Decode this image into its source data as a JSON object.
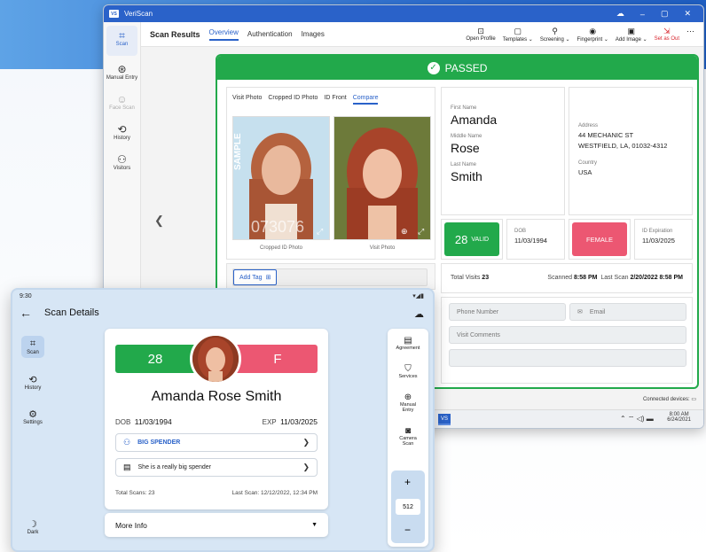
{
  "desktop": {
    "app_title": "VeriScan",
    "app_logo": "VS",
    "sidebar": [
      {
        "icon": "scan-icon",
        "glyph": "⌗",
        "label": "Scan"
      },
      {
        "icon": "manual-entry-icon",
        "glyph": "⊛",
        "label": "Manual Entry"
      },
      {
        "icon": "face-scan-icon",
        "glyph": "☺",
        "label": "Face Scan"
      },
      {
        "icon": "history-icon",
        "glyph": "⟲",
        "label": "History"
      },
      {
        "icon": "visitors-icon",
        "glyph": "⚇",
        "label": "Visitors"
      }
    ],
    "header": {
      "title": "Scan Results",
      "tabs": [
        "Overview",
        "Authentication",
        "Images"
      ]
    },
    "tools": [
      {
        "icon": "open-profile-icon",
        "glyph": "⊡",
        "label": "Open Profile"
      },
      {
        "icon": "templates-icon",
        "glyph": "▢",
        "label": "Templates ⌄"
      },
      {
        "icon": "screening-icon",
        "glyph": "⚲",
        "label": "Screening ⌄"
      },
      {
        "icon": "fingerprint-icon",
        "glyph": "◉",
        "label": "Fingerprint ⌄"
      },
      {
        "icon": "add-image-icon",
        "glyph": "▣",
        "label": "Add Image ⌄"
      },
      {
        "icon": "set-as-out-icon",
        "glyph": "⇲",
        "label": "Set as Out"
      },
      {
        "icon": "more-icon",
        "glyph": "⋯",
        "label": ""
      }
    ],
    "status": "PASSED",
    "image_tabs": [
      "Visit Photo",
      "Cropped ID Photo",
      "ID Front",
      "Compare"
    ],
    "photo_captions": [
      "Cropped ID Photo",
      "Visit Photo"
    ],
    "sample_watermark": "SAMPLE",
    "id_digits": "073076",
    "add_tag": "Add Tag",
    "name": {
      "first_label": "First Name",
      "first": "Amanda",
      "middle_label": "Middle Name",
      "middle": "Rose",
      "last_label": "Last Name",
      "last": "Smith"
    },
    "address": {
      "label": "Address",
      "line1": "44 MECHANIC ST",
      "line2": "WESTFIELD, LA, 01032-4312",
      "country_label": "Country",
      "country": "USA"
    },
    "age": "28",
    "valid": "VALID",
    "dob_label": "DOB",
    "dob": "11/03/1994",
    "gender": "FEMALE",
    "exp_label": "ID Expiration",
    "exp": "11/03/2025",
    "visits_label": "Total Visits",
    "visits": "23",
    "scanned_label": "Scanned",
    "scanned": "8:58 PM",
    "last_scan_label": "Last Scan",
    "last_scan": "2/20/2022  8:58 PM",
    "phone_placeholder": "Phone Number",
    "email_placeholder": "Email",
    "comments_placeholder": "Visit Comments",
    "connected_devices": "Connected devices:",
    "tray_time": "8:00 AM",
    "tray_date": "6/24/2021",
    "taskbar_app": "VS"
  },
  "tablet": {
    "time": "9:30",
    "title": "Scan Details",
    "nav": [
      {
        "icon": "scan-icon",
        "glyph": "⌗",
        "label": "Scan"
      },
      {
        "icon": "history-icon",
        "glyph": "⟲",
        "label": "History"
      },
      {
        "icon": "settings-icon",
        "glyph": "⚙",
        "label": "Settings"
      }
    ],
    "dark_label": "Dark",
    "age": "28",
    "sex": "F",
    "full_name": "Amanda Rose Smith",
    "dob_label": "DOB",
    "dob": "11/03/1994",
    "exp_label": "EXP",
    "exp": "11/03/2025",
    "tag": "BIG SPENDER",
    "note": "She is a really big spender",
    "total_scans": "Total Scans: 23",
    "last_scan": "Last Scan: 12/12/2022, 12:34 PM",
    "more_info": "More Info",
    "actions": [
      {
        "icon": "agreement-icon",
        "glyph": "▤",
        "label": "Agreement"
      },
      {
        "icon": "services-icon",
        "glyph": "⛉",
        "label": "Services"
      },
      {
        "icon": "manual-entry-icon",
        "glyph": "⊕",
        "label": "Manual Entry"
      },
      {
        "icon": "camera-scan-icon",
        "glyph": "◙",
        "label": "Camera Scan"
      }
    ],
    "zoom_value": "512"
  },
  "colors": {
    "brand": "#2a62c9",
    "pass": "#22a94b",
    "female": "#ec5772"
  }
}
